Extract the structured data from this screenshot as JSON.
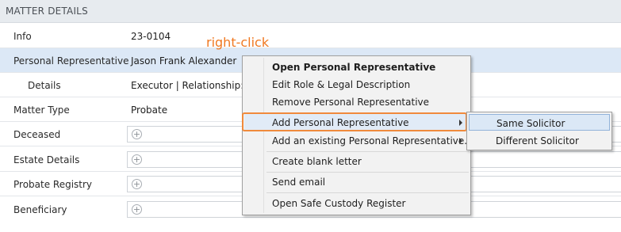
{
  "header": {
    "title": "MATTER DETAILS"
  },
  "rows": [
    {
      "label": "Info",
      "value": "23-0104"
    },
    {
      "label": "Personal Representative",
      "value": "Jason Frank Alexander"
    },
    {
      "label": "Details",
      "value": "Executor | Relationship: M"
    },
    {
      "label": "Matter Type",
      "value": "Probate"
    },
    {
      "label": "Deceased",
      "value": ""
    },
    {
      "label": "Estate Details",
      "value": ""
    },
    {
      "label": "Probate Registry",
      "value": ""
    },
    {
      "label": "Beneficiary",
      "value": ""
    }
  ],
  "annotation": "right-click",
  "context_menu": {
    "items": [
      {
        "label": "Open Personal Representative"
      },
      {
        "label": "Edit Role & Legal Description"
      },
      {
        "label": "Remove Personal Representative"
      },
      {
        "label": "Add Personal Representative"
      },
      {
        "label": "Add an existing Personal Representative..."
      },
      {
        "label": "Create blank letter"
      },
      {
        "label": "Send email"
      },
      {
        "label": "Open Safe Custody Register"
      }
    ]
  },
  "submenu": {
    "items": [
      {
        "label": "Same Solicitor"
      },
      {
        "label": "Different Solicitor"
      }
    ]
  },
  "colors": {
    "accent": "#f08a3c",
    "annotation": "#f07820",
    "selection": "#dce8f6"
  },
  "icons": {
    "add": "plus-circle-icon",
    "submenu_arrow": "chevron-right-icon"
  }
}
